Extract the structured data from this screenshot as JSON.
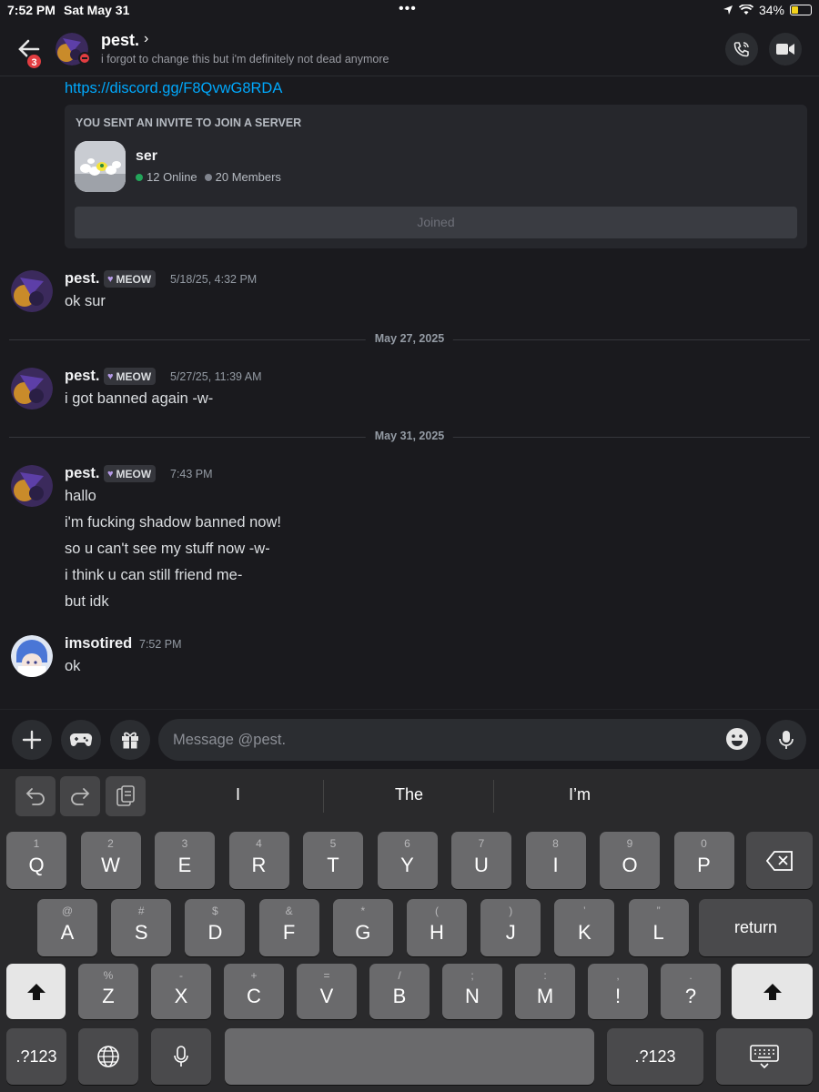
{
  "status_bar": {
    "time": "7:52 PM",
    "date": "Sat May 31",
    "battery": "34%"
  },
  "header": {
    "unread_count": "3",
    "name": "pest.",
    "chevron": "›",
    "status_text": "i forgot to change this but i'm definitely not dead anymore"
  },
  "chat": {
    "link": "https://discord.gg/F8QvwG8RDA",
    "invite": {
      "title": "YOU SENT AN INVITE TO JOIN A SERVER",
      "server_name": "ser",
      "online": "12 Online",
      "members": "20 Members",
      "button": "Joined"
    },
    "messages": [
      {
        "author": "pest.",
        "tag": "MEOW",
        "time": "5/18/25, 4:32 PM",
        "lines": [
          "ok sur"
        ]
      },
      {
        "author": "pest.",
        "tag": "MEOW",
        "time": "5/27/25, 11:39 AM",
        "lines": [
          "i got banned again -w-"
        ]
      },
      {
        "author": "pest.",
        "tag": "MEOW",
        "time": "7:43 PM",
        "lines": [
          "hallo",
          "i'm fucking shadow banned now!",
          "so u can't see my stuff now -w-",
          "i think u can still friend me-",
          "but idk"
        ]
      },
      {
        "author": "imsotired",
        "time": "7:52 PM",
        "lines": [
          "ok"
        ]
      }
    ],
    "dividers": [
      "May 27, 2025",
      "May 31, 2025"
    ]
  },
  "composer": {
    "placeholder": "Message @pest."
  },
  "keyboard": {
    "suggestions": [
      "I",
      "The",
      "I’m"
    ],
    "row1": [
      [
        "Q",
        "1"
      ],
      [
        "W",
        "2"
      ],
      [
        "E",
        "3"
      ],
      [
        "R",
        "4"
      ],
      [
        "T",
        "5"
      ],
      [
        "Y",
        "6"
      ],
      [
        "U",
        "7"
      ],
      [
        "I",
        "8"
      ],
      [
        "O",
        "9"
      ],
      [
        "P",
        "0"
      ]
    ],
    "row2": [
      [
        "A",
        "@"
      ],
      [
        "S",
        "#"
      ],
      [
        "D",
        "$"
      ],
      [
        "F",
        "&"
      ],
      [
        "G",
        "*"
      ],
      [
        "H",
        "("
      ],
      [
        "J",
        ")"
      ],
      [
        "K",
        "’"
      ],
      [
        "L",
        "”"
      ]
    ],
    "row3": [
      [
        "Z",
        "%"
      ],
      [
        "X",
        "-"
      ],
      [
        "C",
        "+"
      ],
      [
        "V",
        "="
      ],
      [
        "B",
        "/"
      ],
      [
        "N",
        ";"
      ],
      [
        "M",
        ":"
      ],
      [
        "!",
        ","
      ],
      [
        "?",
        "."
      ]
    ],
    "return_label": "return",
    "numbers_label": ".?123"
  },
  "colors": {
    "accent_link": "#00a8fc",
    "dnd": "#e23d41",
    "online": "#23a55a"
  }
}
